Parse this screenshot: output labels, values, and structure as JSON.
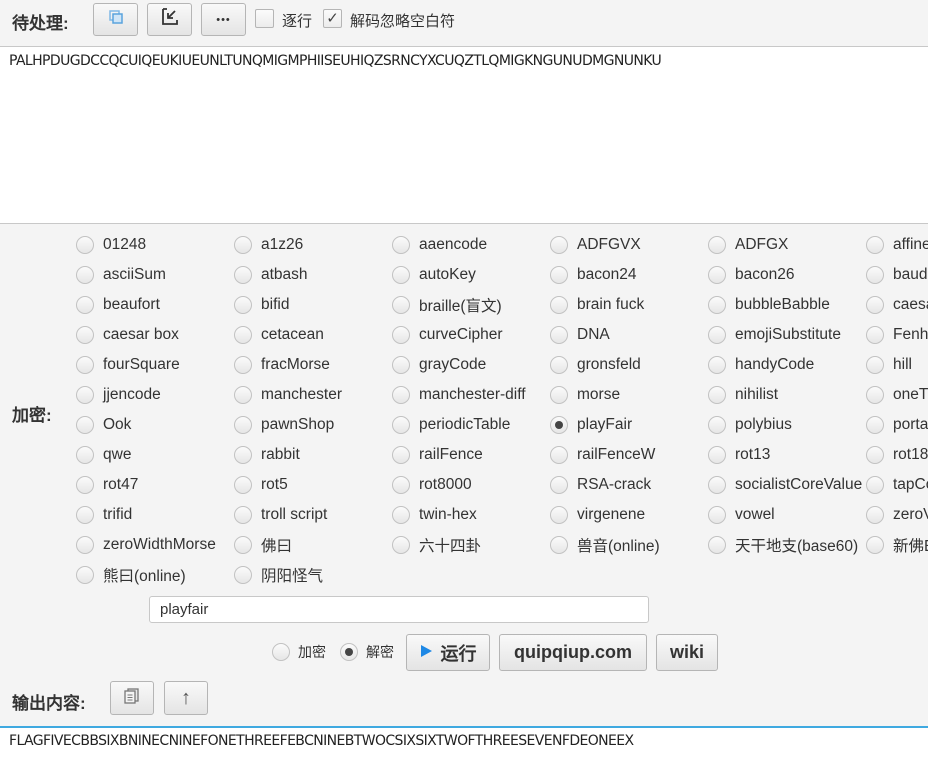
{
  "input_section": {
    "label": "待处理:",
    "buttons": [
      {
        "name": "copy-layers-button",
        "icon": "layers-icon"
      },
      {
        "name": "import-button",
        "icon": "arrow-down-left-icon"
      },
      {
        "name": "more-button",
        "icon": "ellipsis-icon",
        "glyph": "•••"
      }
    ],
    "line_by_line": {
      "label": "逐行",
      "checked": false
    },
    "ignore_whitespace": {
      "label": "解码忽略空白符",
      "checked": true,
      "mark": "✓"
    },
    "text": "PALHPDUGDCCQCUIQEUKIUEUNLTUNQMIGMPHIISEUHIQZSRNCYXCUQZTLQMIGKNGUNUDMGNUNKU"
  },
  "cipher_section": {
    "label": "加密:",
    "selected": "playFair",
    "rows": [
      [
        "01248",
        "a1z26",
        "aaencode",
        "ADFGVX",
        "ADFGX",
        "affine"
      ],
      [
        "asciiSum",
        "atbash",
        "autoKey",
        "bacon24",
        "bacon26",
        "baud"
      ],
      [
        "beaufort",
        "bifid",
        "braille(盲文)",
        "brain fuck",
        "bubbleBabble",
        "caesa"
      ],
      [
        "caesar box",
        "cetacean",
        "curveCipher",
        "DNA",
        "emojiSubstitute",
        "Fenh"
      ],
      [
        "fourSquare",
        "fracMorse",
        "grayCode",
        "gronsfeld",
        "handyCode",
        "hill"
      ],
      [
        "jjencode",
        "manchester",
        "manchester-diff",
        "morse",
        "nihilist",
        "oneT"
      ],
      [
        "Ook",
        "pawnShop",
        "periodicTable",
        "playFair",
        "polybius",
        "porta"
      ],
      [
        "qwe",
        "rabbit",
        "railFence",
        "railFenceW",
        "rot13",
        "rot18"
      ],
      [
        "rot47",
        "rot5",
        "rot8000",
        "RSA-crack",
        "socialistCoreValue",
        "tapCo"
      ],
      [
        "trifid",
        "troll script",
        "twin-hex",
        "virgenene",
        "vowel",
        "zeroV"
      ],
      [
        "zeroWidthMorse",
        "佛曰",
        "六十四卦",
        "兽音(online)",
        "天干地支(base60)",
        "新佛E"
      ],
      [
        "熊曰(online)",
        "阴阳怪气"
      ]
    ],
    "key_input": {
      "value": "playfair"
    },
    "mode": {
      "encrypt_label": "加密",
      "decrypt_label": "解密",
      "selected": "decrypt"
    },
    "run_button": {
      "label": "运行",
      "icon": "play-icon",
      "icon_color": "#1e88e5"
    },
    "quipqiup_button": {
      "label": "quipqiup.com"
    },
    "wiki_button": {
      "label": "wiki"
    }
  },
  "output_section": {
    "label": "输出内容:",
    "buttons": [
      {
        "name": "copy-output-button",
        "icon": "clipboard-icon"
      },
      {
        "name": "move-up-button",
        "icon": "arrow-up-icon",
        "glyph": "↑"
      }
    ],
    "text": "FLAGFIVECBBSIXBNINECNINEFONETHREEFEBCNINEBTWOCSIXSIXTWOFTHREESEVENFDEONEEX"
  },
  "colors": {
    "accent": "#1e88e5",
    "focus_border": "#3fa9e0"
  }
}
